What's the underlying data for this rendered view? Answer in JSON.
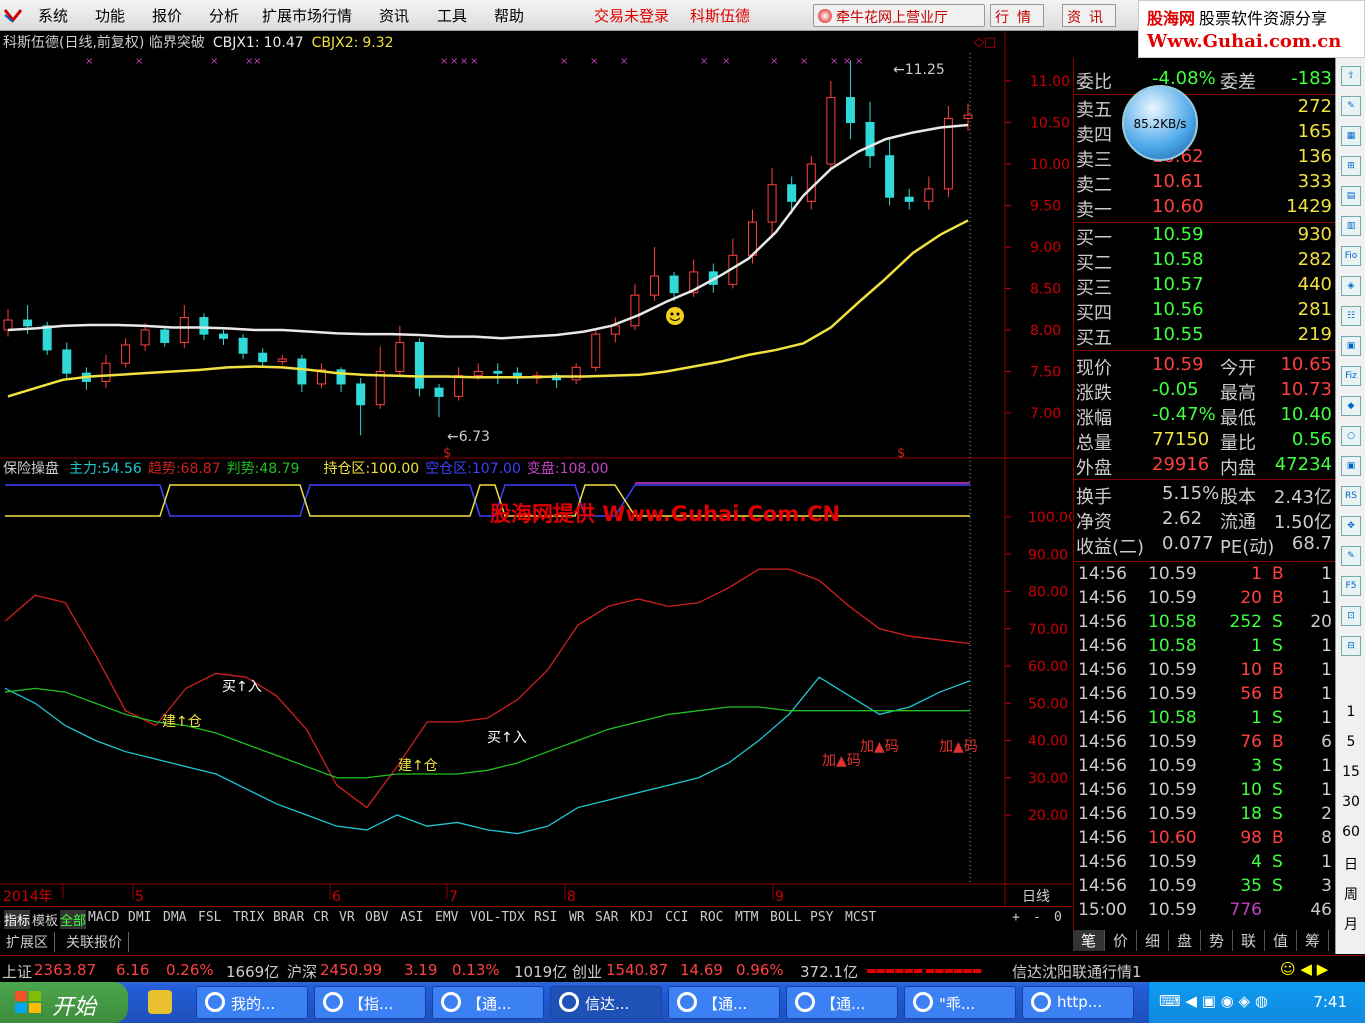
{
  "menu": {
    "items": [
      "系统",
      "功能",
      "报价",
      "分析",
      "扩展市场行情",
      "资讯",
      "工具",
      "帮助"
    ],
    "status_trade": "交易未登录",
    "status_stock": "科斯伍德",
    "broker_button": "牵牛花网上营业厅",
    "btn_quote": "行情",
    "btn_news": "资讯"
  },
  "watermark": {
    "name": "股海网",
    "tagline": "股票软件资源分享",
    "url": "Www.Guhai.com.cn",
    "center_text": "股海网提供 Www.Guhai.Com.CN"
  },
  "chart_title": {
    "name": "科斯伍德(日线,前复权) 临界突破",
    "cbjx1_label": "CBJX1:",
    "cbjx1_value": "10.47",
    "cbjx2_label": "CBJX2:",
    "cbjx2_value": "9.32"
  },
  "chart_data": [
    {
      "type": "candlestick",
      "title": "科斯伍德(日线,前复权)",
      "y_axis_ticks": [
        "11.00",
        "10.50",
        "10.00",
        "9.50",
        "9.00",
        "8.50",
        "8.00",
        "7.50",
        "7.00"
      ],
      "ylim": [
        6.6,
        11.4
      ],
      "annotations": {
        "high": "11.25",
        "low": "6.73"
      },
      "series": [
        {
          "name": "CBJX1",
          "color": "#e8e8e8",
          "values": [
            8.0,
            8.02,
            8.05,
            8.06,
            8.06,
            8.05,
            8.03,
            8.03,
            8.02,
            8.0,
            8.0,
            7.98,
            7.96,
            7.95,
            7.95,
            7.94,
            7.92,
            7.92,
            7.9,
            7.92,
            7.94,
            7.98,
            8.05,
            8.18,
            8.34,
            8.48,
            8.66,
            8.86,
            9.18,
            9.62,
            9.94,
            10.15,
            10.3,
            10.38,
            10.44,
            10.47
          ]
        },
        {
          "name": "CBJX2",
          "color": "#f0e040",
          "values": [
            7.2,
            7.3,
            7.4,
            7.44,
            7.46,
            7.48,
            7.5,
            7.52,
            7.55,
            7.56,
            7.55,
            7.52,
            7.48,
            7.46,
            7.45,
            7.44,
            7.44,
            7.43,
            7.43,
            7.43,
            7.44,
            7.44,
            7.45,
            7.46,
            7.5,
            7.56,
            7.62,
            7.7,
            7.76,
            7.84,
            8.03,
            8.33,
            8.62,
            8.93,
            9.15,
            9.32
          ]
        }
      ],
      "candles": [
        [
          8.0,
          8.12,
          8.25,
          7.92
        ],
        [
          8.12,
          8.05,
          8.3,
          7.95
        ],
        [
          8.05,
          7.76,
          8.1,
          7.7
        ],
        [
          7.76,
          7.48,
          7.85,
          7.4
        ],
        [
          7.48,
          7.38,
          7.55,
          7.28
        ],
        [
          7.38,
          7.6,
          7.7,
          7.3
        ],
        [
          7.6,
          7.82,
          7.9,
          7.55
        ],
        [
          7.82,
          8.0,
          8.08,
          7.75
        ],
        [
          8.0,
          7.85,
          8.05,
          7.8
        ],
        [
          7.85,
          8.15,
          8.3,
          7.78
        ],
        [
          8.15,
          7.95,
          8.2,
          7.88
        ],
        [
          7.95,
          7.9,
          8.0,
          7.82
        ],
        [
          7.9,
          7.72,
          7.95,
          7.65
        ],
        [
          7.72,
          7.62,
          7.78,
          7.55
        ],
        [
          7.62,
          7.65,
          7.7,
          7.58
        ],
        [
          7.65,
          7.35,
          7.7,
          7.25
        ],
        [
          7.35,
          7.52,
          7.6,
          7.3
        ],
        [
          7.52,
          7.35,
          7.55,
          7.25
        ],
        [
          7.35,
          7.1,
          7.42,
          6.73
        ],
        [
          7.1,
          7.5,
          7.8,
          7.05
        ],
        [
          7.5,
          7.85,
          8.05,
          7.45
        ],
        [
          7.85,
          7.3,
          7.9,
          7.2
        ],
        [
          7.3,
          7.2,
          7.35,
          6.95
        ],
        [
          7.2,
          7.45,
          7.55,
          7.15
        ],
        [
          7.45,
          7.5,
          7.6,
          7.4
        ],
        [
          7.5,
          7.48,
          7.6,
          7.35
        ],
        [
          7.48,
          7.42,
          7.55,
          7.35
        ],
        [
          7.42,
          7.45,
          7.5,
          7.35
        ],
        [
          7.45,
          7.4,
          7.48,
          7.3
        ],
        [
          7.4,
          7.55,
          7.6,
          7.35
        ],
        [
          7.55,
          7.95,
          8.0,
          7.5
        ],
        [
          7.95,
          8.05,
          8.15,
          7.85
        ],
        [
          8.05,
          8.42,
          8.55,
          8.0
        ],
        [
          8.42,
          8.65,
          9.0,
          8.35
        ],
        [
          8.65,
          8.45,
          8.7,
          8.35
        ],
        [
          8.45,
          8.7,
          8.85,
          8.4
        ],
        [
          8.7,
          8.55,
          8.8,
          8.45
        ],
        [
          8.55,
          8.9,
          9.1,
          8.5
        ],
        [
          8.9,
          9.3,
          9.45,
          8.8
        ],
        [
          9.3,
          9.75,
          9.95,
          9.15
        ],
        [
          9.75,
          9.55,
          9.85,
          9.4
        ],
        [
          9.55,
          10.0,
          10.1,
          9.45
        ],
        [
          10.0,
          10.8,
          11.0,
          9.95
        ],
        [
          10.8,
          10.5,
          11.25,
          10.3
        ],
        [
          10.5,
          10.1,
          10.75,
          9.95
        ],
        [
          10.1,
          9.6,
          10.3,
          9.5
        ],
        [
          9.6,
          9.55,
          9.7,
          9.45
        ],
        [
          9.55,
          9.7,
          9.85,
          9.45
        ],
        [
          9.7,
          10.55,
          10.7,
          9.6
        ],
        [
          10.55,
          10.59,
          10.73,
          10.4
        ]
      ]
    },
    {
      "type": "line",
      "title": "保险操盘",
      "y_axis_ticks": [
        "100.00",
        "90.00",
        "80.00",
        "70.00",
        "60.00",
        "50.00",
        "40.00",
        "30.00",
        "20.00"
      ],
      "ylim": [
        20,
        100
      ],
      "x_labels": [
        "2014年",
        "5",
        "6",
        "7",
        "8",
        "9"
      ],
      "series": [
        {
          "name": "主力",
          "color": "#20c8d0",
          "values": [
            54,
            50,
            44,
            40,
            37,
            35,
            33,
            31,
            27,
            23,
            20,
            17,
            16,
            20,
            17,
            18,
            16,
            15,
            17,
            22,
            24,
            26,
            28,
            30,
            34,
            40,
            47,
            57,
            52,
            47,
            49,
            53,
            56
          ]
        },
        {
          "name": "趋势",
          "color": "#d02020",
          "values": [
            72,
            79,
            77,
            63,
            48,
            44,
            54,
            58,
            57,
            52,
            43,
            28,
            22,
            33,
            45,
            45,
            46,
            51,
            59,
            71,
            76,
            78,
            76,
            77,
            81,
            86,
            86,
            83,
            76,
            70,
            68,
            67,
            66
          ]
        },
        {
          "name": "判势",
          "color": "#20c020",
          "values": [
            53,
            54,
            53,
            50,
            47,
            45,
            44,
            42,
            39,
            36,
            33,
            30,
            30,
            31,
            31,
            31,
            32,
            34,
            37,
            40,
            43,
            45,
            47,
            48,
            49,
            49,
            48,
            48,
            48,
            48,
            48,
            48,
            48
          ]
        }
      ],
      "legend": [
        {
          "name": "主力",
          "value": "54.56",
          "color": "#20c8d0"
        },
        {
          "name": "趋势",
          "value": "68.87",
          "color": "#d02020"
        },
        {
          "name": "判势",
          "value": "48.79",
          "color": "#20c020"
        },
        {
          "name": "持仓区",
          "value": "100.00",
          "color": "#f0e040"
        },
        {
          "name": "空仓区",
          "value": "107.00",
          "color": "#4040ff"
        },
        {
          "name": "变盘",
          "value": "108.00",
          "color": "#c040c0"
        }
      ],
      "annotations": [
        "建↑仓",
        "买↑入",
        "建↑仓",
        "买↑入",
        "加▲码",
        "加▲码",
        "加▲码"
      ]
    }
  ],
  "sub_title": "保险操盘",
  "index_tabs": [
    "指标",
    "模板",
    "全部",
    "MACD",
    "DMI",
    "DMA",
    "FSL",
    "TRIX",
    "BRAR",
    "CR",
    "VR",
    "OBV",
    "ASI",
    "EMV",
    "VOL-TDX",
    "RSI",
    "WR",
    "SAR",
    "KDJ",
    "CCI",
    "ROC",
    "MTM",
    "BOLL",
    "PSY",
    "MCST"
  ],
  "index_controls": [
    "+",
    "-",
    "0"
  ],
  "bottom_tabs": [
    "扩展区",
    "关联报价"
  ],
  "period_label": "日线",
  "quote": {
    "weibi_label": "委比",
    "weibi": "-4.08%",
    "weicha_label": "委差",
    "weicha": "-183",
    "asks": [
      {
        "label": "卖五",
        "price": "",
        "vol": "272"
      },
      {
        "label": "卖四",
        "price": "",
        "vol": "165"
      },
      {
        "label": "卖三",
        "price": "10.62",
        "vol": "136"
      },
      {
        "label": "卖二",
        "price": "10.61",
        "vol": "333"
      },
      {
        "label": "卖一",
        "price": "10.60",
        "vol": "1429"
      }
    ],
    "bids": [
      {
        "label": "买一",
        "price": "10.59",
        "vol": "930"
      },
      {
        "label": "买二",
        "price": "10.58",
        "vol": "282"
      },
      {
        "label": "买三",
        "price": "10.57",
        "vol": "440"
      },
      {
        "label": "买四",
        "price": "10.56",
        "vol": "281"
      },
      {
        "label": "买五",
        "price": "10.55",
        "vol": "219"
      }
    ],
    "stats": [
      {
        "l1": "现价",
        "v1": "10.59",
        "l2": "今开",
        "v2": "10.65",
        "c1": "#ff4040",
        "c2": "#ff4040"
      },
      {
        "l1": "涨跌",
        "v1": "-0.05",
        "l2": "最高",
        "v2": "10.73",
        "c1": "#40ff40",
        "c2": "#ff4040"
      },
      {
        "l1": "涨幅",
        "v1": "-0.47%",
        "l2": "最低",
        "v2": "10.40",
        "c1": "#40ff40",
        "c2": "#40ff40"
      },
      {
        "l1": "总量",
        "v1": "77150",
        "l2": "量比",
        "v2": "0.56",
        "c1": "#f0e040",
        "c2": "#40ff40"
      },
      {
        "l1": "外盘",
        "v1": "29916",
        "l2": "内盘",
        "v2": "47234",
        "c1": "#ff4040",
        "c2": "#40ff40"
      }
    ],
    "stats2": [
      {
        "l1": "换手",
        "v1": "5.15%",
        "l2": "股本",
        "v2": "2.43亿"
      },
      {
        "l1": "净资",
        "v1": "2.62",
        "l2": "流通",
        "v2": "1.50亿"
      },
      {
        "l1": "收益(二)",
        "v1": "0.077",
        "l2": "PE(动)",
        "v2": "68.7"
      }
    ],
    "speed": "85.2KB/s"
  },
  "ticks": [
    {
      "t": "14:56",
      "p": "10.59",
      "v": "1",
      "s": "B",
      "n": "1"
    },
    {
      "t": "14:56",
      "p": "10.59",
      "v": "20",
      "s": "B",
      "n": "1"
    },
    {
      "t": "14:56",
      "p": "10.58",
      "v": "252",
      "s": "S",
      "n": "20"
    },
    {
      "t": "14:56",
      "p": "10.58",
      "v": "1",
      "s": "S",
      "n": "1"
    },
    {
      "t": "14:56",
      "p": "10.59",
      "v": "10",
      "s": "B",
      "n": "1"
    },
    {
      "t": "14:56",
      "p": "10.59",
      "v": "56",
      "s": "B",
      "n": "1"
    },
    {
      "t": "14:56",
      "p": "10.58",
      "v": "1",
      "s": "S",
      "n": "1"
    },
    {
      "t": "14:56",
      "p": "10.59",
      "v": "76",
      "s": "B",
      "n": "6"
    },
    {
      "t": "14:56",
      "p": "10.59",
      "v": "3",
      "s": "S",
      "n": "1"
    },
    {
      "t": "14:56",
      "p": "10.59",
      "v": "10",
      "s": "S",
      "n": "1"
    },
    {
      "t": "14:56",
      "p": "10.59",
      "v": "18",
      "s": "S",
      "n": "2"
    },
    {
      "t": "14:56",
      "p": "10.60",
      "v": "98",
      "s": "B",
      "n": "8"
    },
    {
      "t": "14:56",
      "p": "10.59",
      "v": "4",
      "s": "S",
      "n": "1"
    },
    {
      "t": "14:56",
      "p": "10.59",
      "v": "35",
      "s": "S",
      "n": "3"
    },
    {
      "t": "15:00",
      "p": "10.59",
      "v": "776",
      "s": "",
      "n": "46"
    }
  ],
  "right_tabs": [
    "笔",
    "价",
    "细",
    "盘",
    "势",
    "联",
    "值",
    "筹"
  ],
  "side_numbers": [
    "1",
    "5",
    "15",
    "30",
    "60",
    "日",
    "周",
    "月"
  ],
  "status": {
    "sh_label": "上证",
    "sh_value": "2363.87",
    "sh_chg": "6.16",
    "sh_pct": "0.26%",
    "sh_amt": "1669亿",
    "sz_label": "沪深",
    "sz_value": "2450.99",
    "sz_chg": "3.19",
    "sz_pct": "0.13%",
    "sz_amt": "1019亿",
    "cy_label": "创业",
    "cy_value": "1540.87",
    "cy_chg": "14.69",
    "cy_pct": "0.96%",
    "cy_amt": "372.1亿",
    "server": "信达沈阳联通行情1"
  },
  "taskbar": {
    "start": "开始",
    "tasks": [
      "我的...",
      "【指...",
      "【通...",
      "信达...",
      "【通...",
      "【通...",
      "\"乖...",
      "http..."
    ],
    "clock": "7:41"
  }
}
